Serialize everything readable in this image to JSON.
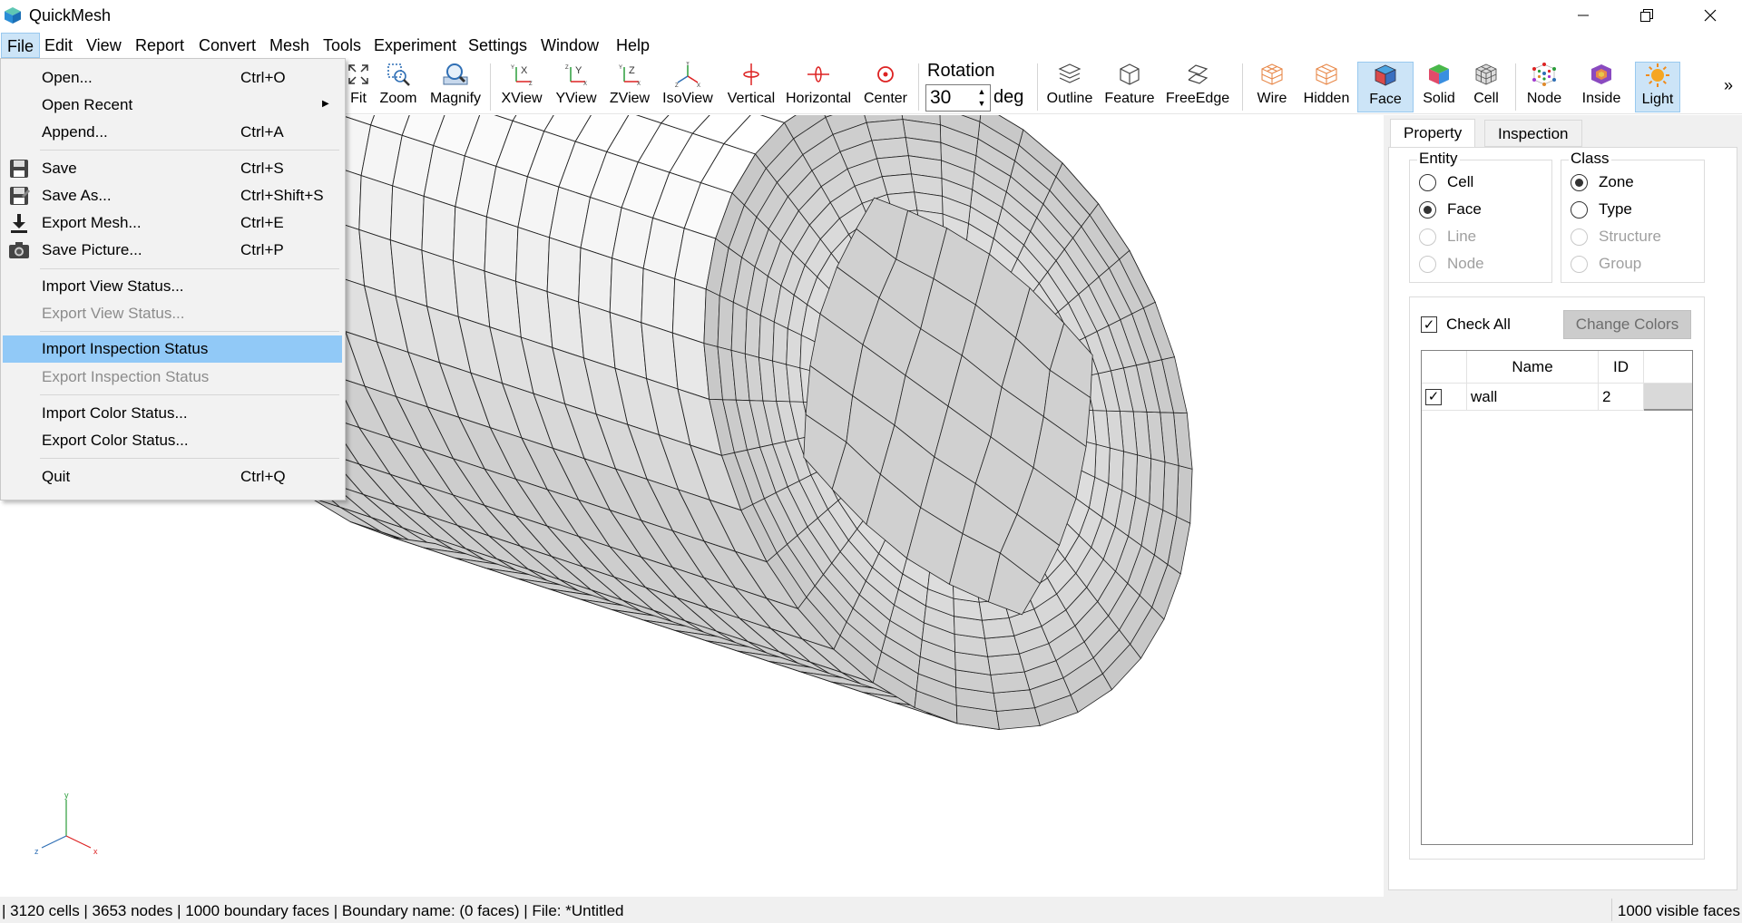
{
  "window": {
    "title": "QuickMesh"
  },
  "menubar": [
    "File",
    "Edit",
    "View",
    "Report",
    "Convert",
    "Mesh",
    "Tools",
    "Experiment",
    "Settings",
    "Window",
    "Help"
  ],
  "toolbar": {
    "view_buttons": [
      {
        "label": "Fit",
        "icon": "fit-icon"
      },
      {
        "label": "Zoom",
        "icon": "zoom-icon"
      },
      {
        "label": "Magnify",
        "icon": "magnify-icon"
      },
      {
        "label": "XView",
        "icon": "xview-icon"
      },
      {
        "label": "YView",
        "icon": "yview-icon"
      },
      {
        "label": "ZView",
        "icon": "zview-icon"
      },
      {
        "label": "IsoView",
        "icon": "isoview-icon"
      },
      {
        "label": "Vertical",
        "icon": "vertical-icon"
      },
      {
        "label": "Horizontal",
        "icon": "horizontal-icon"
      },
      {
        "label": "Center",
        "icon": "center-icon"
      }
    ],
    "rotation": {
      "label": "Rotation",
      "value": "30",
      "unit": "deg"
    },
    "render_buttons": [
      {
        "label": "Outline",
        "icon": "outline-icon",
        "active": false
      },
      {
        "label": "Feature",
        "icon": "feature-icon",
        "active": false
      },
      {
        "label": "FreeEdge",
        "icon": "freeedge-icon",
        "active": false
      },
      {
        "label": "Wire",
        "icon": "wire-icon",
        "active": false
      },
      {
        "label": "Hidden",
        "icon": "hidden-icon",
        "active": false
      },
      {
        "label": "Face",
        "icon": "face-icon",
        "active": true
      },
      {
        "label": "Solid",
        "icon": "solid-icon",
        "active": false
      },
      {
        "label": "Cell",
        "icon": "cell-icon",
        "active": false
      },
      {
        "label": "Node",
        "icon": "node-icon",
        "active": false
      },
      {
        "label": "Inside",
        "icon": "inside-icon",
        "active": false
      },
      {
        "label": "Light",
        "icon": "light-icon",
        "active": true
      }
    ],
    "overflow": "»"
  },
  "file_menu": [
    {
      "label": "Open...",
      "shortcut": "Ctrl+O",
      "icon": null,
      "disabled": false
    },
    {
      "label": "Open Recent",
      "shortcut": "",
      "submenu": true,
      "icon": null,
      "disabled": false
    },
    {
      "label": "Append...",
      "shortcut": "Ctrl+A",
      "icon": null,
      "disabled": false
    },
    {
      "separator": true
    },
    {
      "label": "Save",
      "shortcut": "Ctrl+S",
      "icon": "floppy-disk-icon",
      "disabled": false
    },
    {
      "label": "Save As...",
      "shortcut": "Ctrl+Shift+S",
      "icon": "save-as-icon",
      "disabled": false
    },
    {
      "label": "Export Mesh...",
      "shortcut": "Ctrl+E",
      "icon": "download-arrow-icon",
      "disabled": false
    },
    {
      "label": "Save Picture...",
      "shortcut": "Ctrl+P",
      "icon": "camera-icon",
      "disabled": false
    },
    {
      "separator": true
    },
    {
      "label": "Import View Status...",
      "shortcut": "",
      "icon": null,
      "disabled": false
    },
    {
      "label": "Export View Status...",
      "shortcut": "",
      "icon": null,
      "disabled": true
    },
    {
      "separator": true
    },
    {
      "label": "Import Inspection Status",
      "shortcut": "",
      "icon": null,
      "disabled": false,
      "highlighted": true
    },
    {
      "label": "Export Inspection Status",
      "shortcut": "",
      "icon": null,
      "disabled": true
    },
    {
      "separator": true
    },
    {
      "label": "Import Color Status...",
      "shortcut": "",
      "icon": null,
      "disabled": false
    },
    {
      "label": "Export Color Status...",
      "shortcut": "",
      "icon": null,
      "disabled": false
    },
    {
      "separator": true
    },
    {
      "label": "Quit",
      "shortcut": "Ctrl+Q",
      "icon": null,
      "disabled": false
    }
  ],
  "axes": {
    "x": "x",
    "y": "y",
    "z": "z"
  },
  "panel": {
    "tabs": [
      {
        "label": "Property",
        "active": true
      },
      {
        "label": "Inspection",
        "active": false
      }
    ],
    "entity": {
      "title": "Entity",
      "options": [
        {
          "label": "Cell",
          "selected": false,
          "disabled": false
        },
        {
          "label": "Face",
          "selected": true,
          "disabled": false
        },
        {
          "label": "Line",
          "selected": false,
          "disabled": true
        },
        {
          "label": "Node",
          "selected": false,
          "disabled": true
        }
      ]
    },
    "class": {
      "title": "Class",
      "options": [
        {
          "label": "Zone",
          "selected": true,
          "disabled": false
        },
        {
          "label": "Type",
          "selected": false,
          "disabled": false
        },
        {
          "label": "Structure",
          "selected": false,
          "disabled": true
        },
        {
          "label": "Group",
          "selected": false,
          "disabled": true
        }
      ]
    },
    "check_all": {
      "label": "Check All",
      "checked": true
    },
    "change_colors": "Change Colors",
    "table": {
      "columns": [
        "Name",
        "ID"
      ],
      "rows": [
        {
          "checked": true,
          "name": "wall",
          "id": "2",
          "color": "#d9d9d9"
        }
      ]
    }
  },
  "statusbar": {
    "left": "| 3120 cells | 3653 nodes | 1000 boundary faces |  Boundary name:  (0 faces) | File: *Untitled",
    "right": "1000 visible faces"
  },
  "colors": {
    "accent": "#cce4f7",
    "menu_highlight": "#91c9f7",
    "mesh_light": "#f0f0f0",
    "mesh_dark": "#cfcfcf"
  }
}
